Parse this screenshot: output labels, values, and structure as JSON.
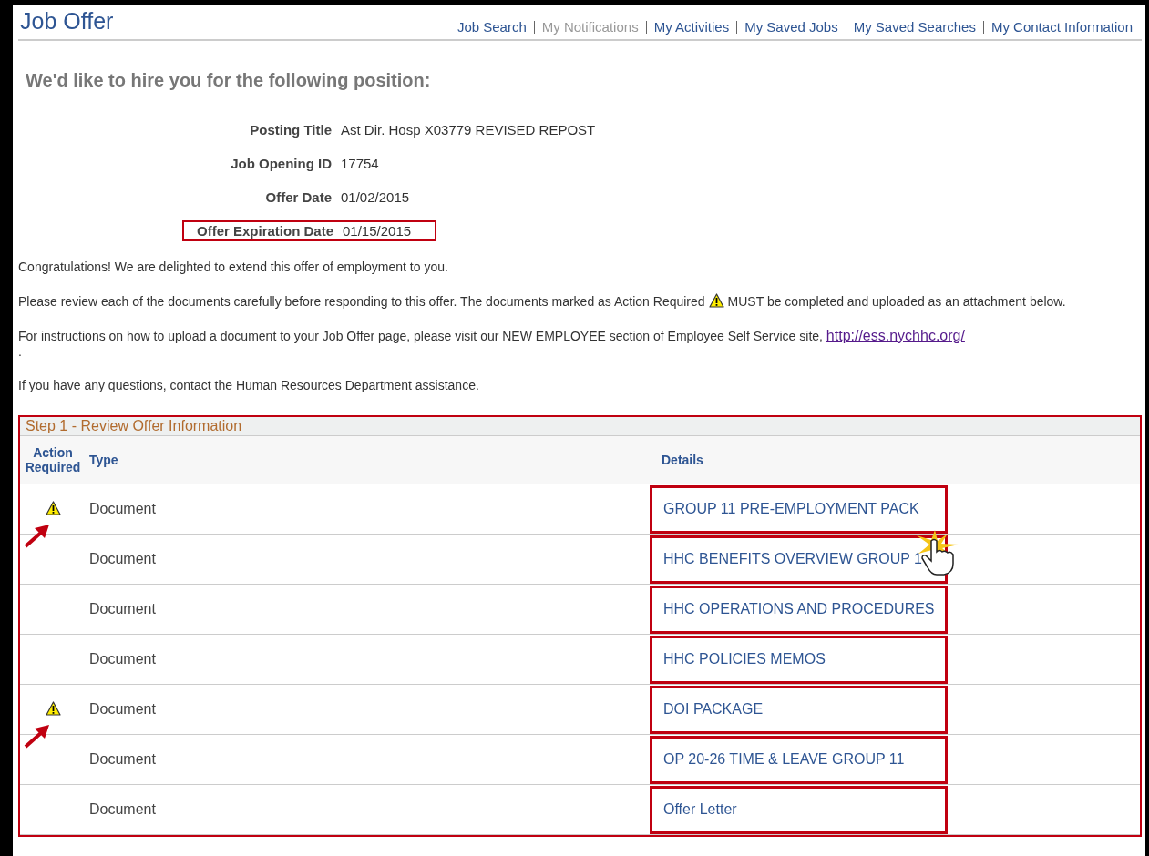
{
  "page_title": "Job Offer",
  "nav_links": [
    {
      "label": "Job Search",
      "disabled": false
    },
    {
      "label": "My Notifications",
      "disabled": true
    },
    {
      "label": "My Activities",
      "disabled": false
    },
    {
      "label": "My Saved Jobs",
      "disabled": false
    },
    {
      "label": "My Saved Searches",
      "disabled": false
    },
    {
      "label": "My Contact Information",
      "disabled": false
    }
  ],
  "heading": "We'd like to hire you for the following position:",
  "fields": [
    {
      "label": "Posting Title",
      "value": "Ast Dir. Hosp X03779 REVISED REPOST",
      "highlighted": false
    },
    {
      "label": "Job Opening ID",
      "value": "17754",
      "highlighted": false
    },
    {
      "label": "Offer Date",
      "value": "01/02/2015",
      "highlighted": false
    },
    {
      "label": "Offer Expiration Date",
      "value": "01/15/2015",
      "highlighted": true
    }
  ],
  "congratulations": "Congratulations! We are delighted to extend this offer of employment to you.",
  "review_note": {
    "before": "Please review each of the documents carefully before responding to this offer. The documents marked as Action Required",
    "after": "MUST be completed and uploaded as an attachment below."
  },
  "instructions": {
    "text": "For instructions on how to upload a document to your Job Offer page, please visit our NEW EMPLOYEE section of Employee Self Service site,",
    "link": "http://ess.nychhc.org/",
    "end": "."
  },
  "questions": "If you have any questions, contact the Human Resources Department assistance.",
  "step": {
    "title": "Step 1 - Review Offer Information",
    "highlighted": true,
    "columns": [
      "Action Required",
      "Type",
      "Details"
    ],
    "rows": [
      {
        "action_required": true,
        "type": "Document",
        "details": "GROUP 11 PRE-EMPLOYMENT PACK",
        "highlighted": true
      },
      {
        "action_required": false,
        "type": "Document",
        "details": "HHC BENEFITS OVERVIEW GROUP 1",
        "highlighted": true
      },
      {
        "action_required": false,
        "type": "Document",
        "details": "HHC OPERATIONS AND PROCEDURES",
        "highlighted": true
      },
      {
        "action_required": false,
        "type": "Document",
        "details": "HHC POLICIES MEMOS",
        "highlighted": true
      },
      {
        "action_required": true,
        "type": "Document",
        "details": "DOI PACKAGE",
        "highlighted": true
      },
      {
        "action_required": false,
        "type": "Document",
        "details": "OP 20-26 TIME & LEAVE GROUP 11",
        "highlighted": true
      },
      {
        "action_required": false,
        "type": "Document",
        "details": "Offer Letter",
        "highlighted": true
      }
    ]
  }
}
